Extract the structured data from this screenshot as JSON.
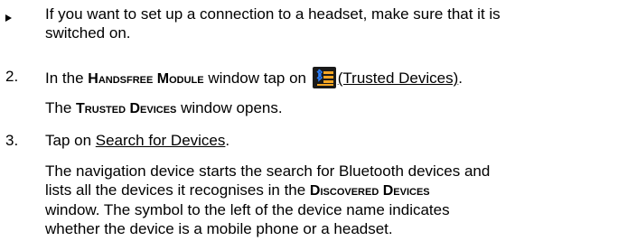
{
  "bullet_item": {
    "line1": "If you want to set up a connection to a headset, make sure that it is",
    "line2": "switched on."
  },
  "step2": {
    "number": "2.",
    "text_before": "In the ",
    "window_name": "Handsfree Module",
    "text_after_window": " window tap on ",
    "icon_name": "trusted-devices-icon",
    "link_text": "(Trusted Devices)",
    "text_end": ".",
    "result_before": "The ",
    "result_window": "Trusted Devices",
    "result_after": " window opens."
  },
  "step3": {
    "number": "3.",
    "text_before": "Tap on ",
    "link_text": "Search for Devices",
    "text_end": ".",
    "para_line1": "The navigation device starts the search for Bluetooth devices and",
    "para_line2_before": "lists all the devices it recognises in the ",
    "para_line2_window": "Discovered Devices",
    "para_line3": "window. The symbol to the left of the device name indicates",
    "para_line4": "whether the device is a mobile phone or a headset."
  },
  "colors": {
    "text": "#000000",
    "icon_bg": "#1a1a1a",
    "icon_orange": "#f5a623",
    "icon_blue": "#2a7fff"
  }
}
